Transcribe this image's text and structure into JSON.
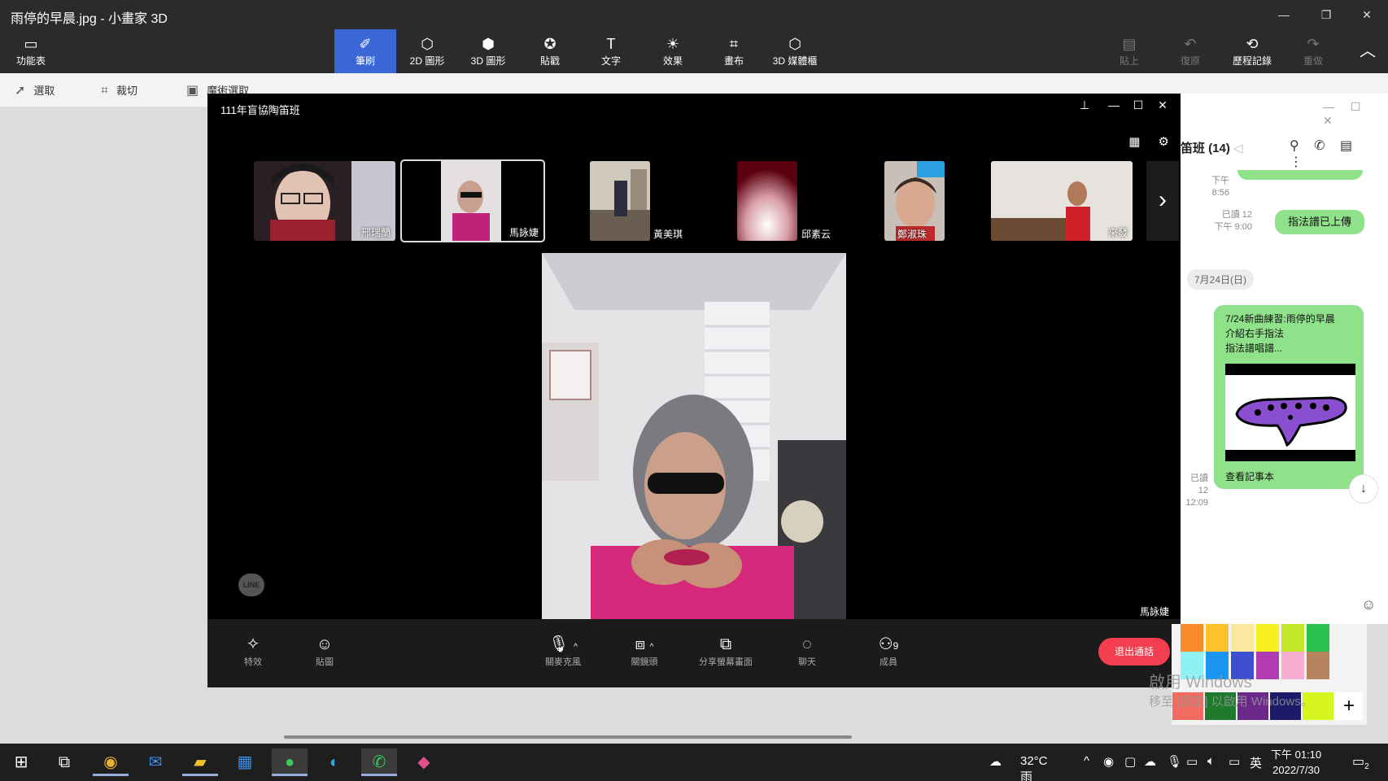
{
  "paint3d": {
    "title": "雨停的早晨.jpg - 小畫家 3D",
    "menu_label": "功能表",
    "ribbon": [
      {
        "label": "筆刷",
        "icon": "brush-icon",
        "glyph": "✐"
      },
      {
        "label": "2D 圖形",
        "icon": "shapes-2d-icon",
        "glyph": "⬡"
      },
      {
        "label": "3D 圖形",
        "icon": "cube-icon",
        "glyph": "⬢"
      },
      {
        "label": "貼戳",
        "icon": "sticker-icon",
        "glyph": "✪"
      },
      {
        "label": "文字",
        "icon": "text-icon",
        "glyph": "T"
      },
      {
        "label": "效果",
        "icon": "effects-icon",
        "glyph": "☀"
      },
      {
        "label": "畫布",
        "icon": "canvas-icon",
        "glyph": "⌗"
      },
      {
        "label": "3D 媒體櫃",
        "icon": "library-3d-icon",
        "glyph": "⬡"
      }
    ],
    "right_ribbon": [
      {
        "label": "貼上",
        "icon": "paste-icon",
        "glyph": "📋"
      },
      {
        "label": "復原",
        "icon": "undo-icon",
        "glyph": "↶"
      },
      {
        "label": "歷程記錄",
        "icon": "history-icon",
        "glyph": "⟲"
      },
      {
        "label": "重做",
        "icon": "redo-icon",
        "glyph": "↷"
      }
    ],
    "toolbar": {
      "select": "選取",
      "crop": "裁切",
      "magic_select": "魔術選取"
    }
  },
  "call": {
    "title": "111年盲協陶笛班",
    "participants": [
      {
        "name": "邢瑞蘭",
        "tone": "#7a5a4e"
      },
      {
        "name": "馬詠婕",
        "tone": "#b03a7a"
      },
      {
        "name": "黃美琪",
        "tone": "#8a8076"
      },
      {
        "name": "邱素云",
        "tone": "#6a0a14"
      },
      {
        "name": "鄭淑珠",
        "tone": "#c08a6a"
      },
      {
        "name": "來發",
        "tone": "#bca898"
      }
    ],
    "main_speaker": "馬詠婕",
    "controls": [
      {
        "label": "特效",
        "icon": "sparkle-icon",
        "glyph": "✧"
      },
      {
        "label": "貼圖",
        "icon": "smile-icon",
        "glyph": "☺"
      },
      {
        "label": "關麥克風",
        "icon": "microphone-icon",
        "glyph": "🎙"
      },
      {
        "label": "關鏡頭",
        "icon": "camera-icon",
        "glyph": "▭"
      },
      {
        "label": "分享螢幕畫面",
        "icon": "share-screen-icon",
        "glyph": "⧉"
      },
      {
        "label": "聊天",
        "icon": "chat-icon",
        "glyph": "💬"
      },
      {
        "label": "成員",
        "icon": "members-icon",
        "glyph": "👤"
      }
    ],
    "member_count": "9",
    "hangup_label": "退出通話",
    "logo_text": "LINE"
  },
  "chat": {
    "group_title": "笛班 (14)",
    "top_meta": "下午 8:56",
    "msg1": {
      "read": "已讀 12",
      "time": "下午 9:00",
      "text": "指法譜已上傳"
    },
    "date_chip": "7月24日(日)",
    "note": {
      "line1": "7/24新曲練習:雨停的早晨",
      "line2": "介紹右手指法",
      "line3": "指法譜唱譜...",
      "link": "查看記事本",
      "read": "已讀 12",
      "time": "12:09"
    }
  },
  "activation": {
    "line1": "啟用 Windows",
    "line2": "移至 [設定] 以啟用 Windows。"
  },
  "palette_colors": [
    "#f98b2c",
    "#fbc22d",
    "#fde69e",
    "#f6ee1e",
    "#c4e62a",
    "#2bc14e",
    "#8ff0f5",
    "#1a96f0",
    "#3e4ed0",
    "#b03bb2",
    "#f8aed0",
    "#b78460",
    "#f26a60",
    "#1f7a2d",
    "#6b2a8a",
    "#1b1b6a",
    "#d6f51f"
  ],
  "taskbar": {
    "weather": "32°C 雨",
    "ime": "英",
    "time": "下午 01:10",
    "date": "2022/7/30",
    "notifications": "2"
  }
}
